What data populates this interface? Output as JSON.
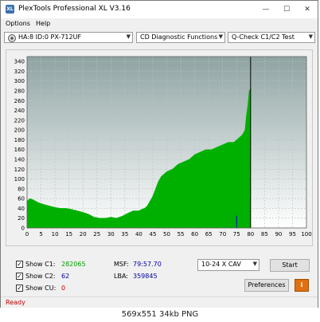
{
  "window": {
    "title": "PlexTools Professional XL V3.16",
    "icon_label": "XL"
  },
  "menu": {
    "options": "Options",
    "help": "Help"
  },
  "toolbar": {
    "drive": "HA:8 ID:0  PX-712UF",
    "function": "CD Diagnostic Functions",
    "test": "Q-Check C1/C2 Test"
  },
  "chart_data": {
    "type": "area",
    "x_ticks": [
      0,
      5,
      10,
      15,
      20,
      25,
      30,
      35,
      40,
      45,
      50,
      55,
      60,
      65,
      70,
      75,
      80,
      85,
      90,
      95,
      100
    ],
    "y_ticks": [
      0,
      20,
      40,
      60,
      80,
      100,
      120,
      140,
      160,
      180,
      200,
      220,
      240,
      260,
      280,
      300,
      320,
      340
    ],
    "xlim": [
      0,
      100
    ],
    "ylim": [
      0,
      350
    ],
    "grid": true,
    "series": [
      {
        "color": "#00b000",
        "x": [
          0,
          1,
          2,
          4,
          6,
          8,
          10,
          12,
          14,
          16,
          18,
          20,
          22,
          24,
          26,
          28,
          30,
          32,
          34,
          36,
          38,
          40,
          41,
          42,
          43,
          44,
          45,
          46,
          47,
          48,
          49,
          50,
          52,
          54,
          56,
          58,
          60,
          62,
          64,
          66,
          68,
          70,
          72,
          74,
          75,
          76,
          77,
          78,
          78.5,
          79,
          79.5,
          80
        ],
        "y": [
          55,
          60,
          58,
          52,
          48,
          45,
          42,
          40,
          40,
          38,
          35,
          32,
          28,
          22,
          20,
          20,
          22,
          20,
          24,
          30,
          35,
          35,
          38,
          40,
          45,
          55,
          65,
          80,
          95,
          105,
          110,
          115,
          120,
          130,
          135,
          140,
          150,
          155,
          160,
          160,
          165,
          170,
          175,
          175,
          180,
          185,
          190,
          200,
          230,
          250,
          280,
          285
        ]
      }
    ],
    "marker_lines": [
      {
        "x": 75,
        "color": "#0000cc",
        "y": 25
      },
      {
        "x": 80,
        "color": "#000000",
        "y": 350
      }
    ]
  },
  "stats": {
    "c1_label": "Show C1:",
    "c1_value": "282065",
    "c2_label": "Show C2:",
    "c2_value": "62",
    "cu_label": "Show CU:",
    "cu_value": "0",
    "msf_label": "MSF:",
    "msf_value": "79:57.70",
    "lba_label": "LBA:",
    "lba_value": "359845"
  },
  "controls": {
    "speed": "10-24 X CAV",
    "start": "Start",
    "preferences": "Preferences",
    "info": "i"
  },
  "status": "Ready",
  "caption": "569x551 34kb PNG",
  "colors": {
    "green": "#00b000",
    "red": "#c00000",
    "blue": "#0000a0",
    "chart_bg_top": "#8fa3a3",
    "chart_bg_bottom": "#ffffff"
  }
}
